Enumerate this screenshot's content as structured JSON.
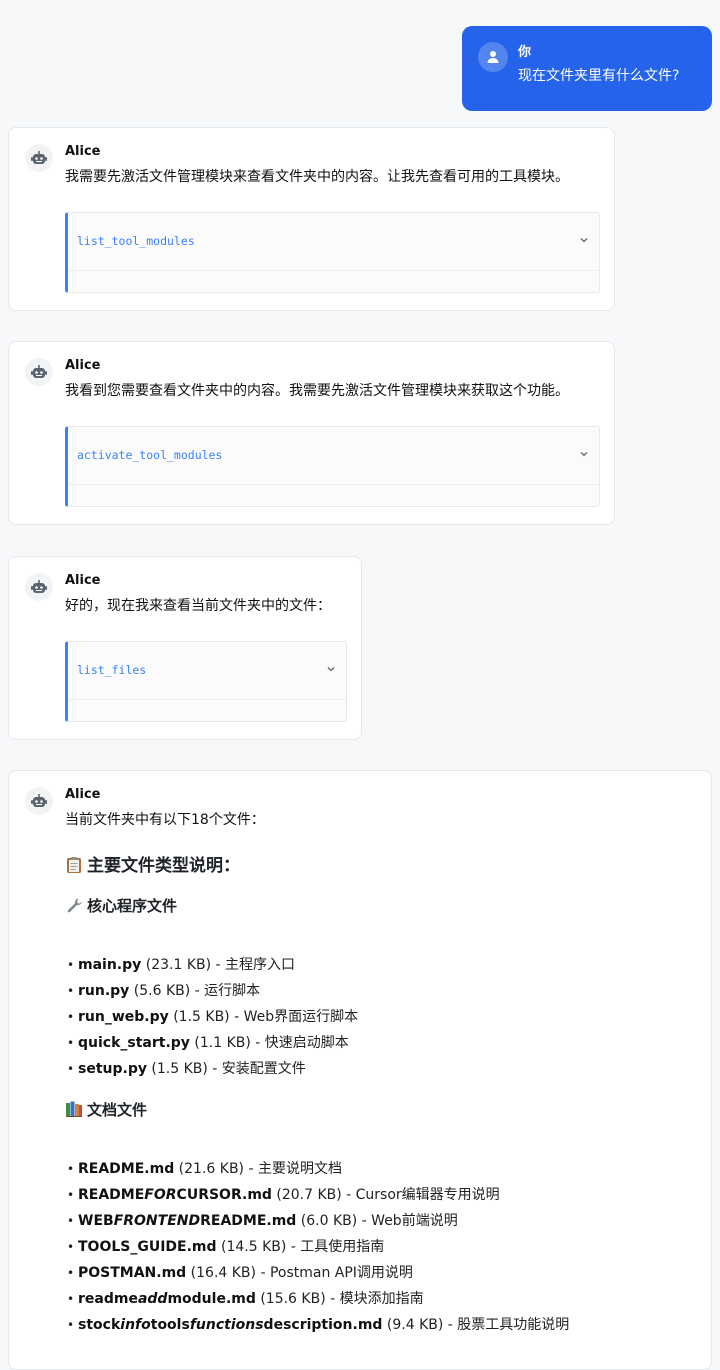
{
  "user_message": {
    "name": "你",
    "text": "现在文件夹里有什么文件?"
  },
  "messages": [
    {
      "name": "Alice",
      "text": "我需要先激活文件管理模块来查看文件夹中的内容。让我先查看可用的工具模块。",
      "tool": "list_tool_modules"
    },
    {
      "name": "Alice",
      "text": "我看到您需要查看文件夹中的内容。我需要先激活文件管理模块来获取这个功能。",
      "tool": "activate_tool_modules"
    },
    {
      "name": "Alice",
      "text": "好的，现在我来查看当前文件夹中的文件：",
      "tool": "list_files"
    },
    {
      "name": "Alice",
      "text": "当前文件夹中有以下18个文件：",
      "heading": "主要文件类型说明：",
      "sections": [
        {
          "title": "核心程序文件",
          "icon": "wrench-icon",
          "files": [
            {
              "name": "main.py",
              "detail": " (23.1 KB) - 主程序入口"
            },
            {
              "name": "run.py",
              "detail": " (5.6 KB) - 运行脚本"
            },
            {
              "name": "run_web.py",
              "detail": " (1.5 KB) - Web界面运行脚本"
            },
            {
              "name": "quick_start.py",
              "detail": " (1.1 KB) - 快速启动脚本"
            },
            {
              "name": "setup.py",
              "detail": " (1.5 KB) - 安装配置文件"
            }
          ]
        },
        {
          "title": "文档文件",
          "icon": "books-icon",
          "files": [
            {
              "name": "README.md",
              "detail": " (21.6 KB) - 主要说明文档"
            },
            {
              "parts": [
                "README",
                "FOR",
                "CURSOR.md"
              ],
              "detail": " (20.7 KB) - Cursor编辑器专用说明"
            },
            {
              "parts": [
                "WEB",
                "FRONTEND",
                "README.md"
              ],
              "detail": " (6.0 KB) - Web前端说明"
            },
            {
              "name": "TOOLS_GUIDE.md",
              "detail": " (14.5 KB) - 工具使用指南"
            },
            {
              "name": "POSTMAN.md",
              "detail": " (16.4 KB) - Postman API调用说明"
            },
            {
              "parts": [
                "readme",
                "add",
                "module.md"
              ],
              "detail": " (15.6 KB) - 模块添加指南"
            },
            {
              "parts": [
                "stock",
                "info",
                "tools",
                "functions",
                "description.md"
              ],
              "detail": " (9.4 KB) - 股票工具功能说明"
            }
          ]
        }
      ]
    }
  ]
}
